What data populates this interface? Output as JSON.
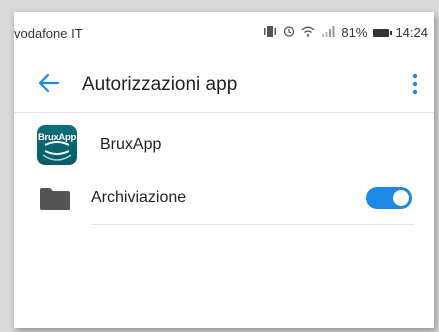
{
  "status_bar": {
    "carrier": "vodafone IT",
    "battery": "81%",
    "time": "14:24"
  },
  "app_bar": {
    "title": "Autorizzazioni app"
  },
  "app": {
    "logo_text": "BruxApp",
    "name": "BruxApp"
  },
  "permissions": [
    {
      "label": "Archiviazione",
      "enabled": true
    }
  ],
  "colors": {
    "accent": "#1e88e5",
    "logo": "#0c6f78"
  }
}
